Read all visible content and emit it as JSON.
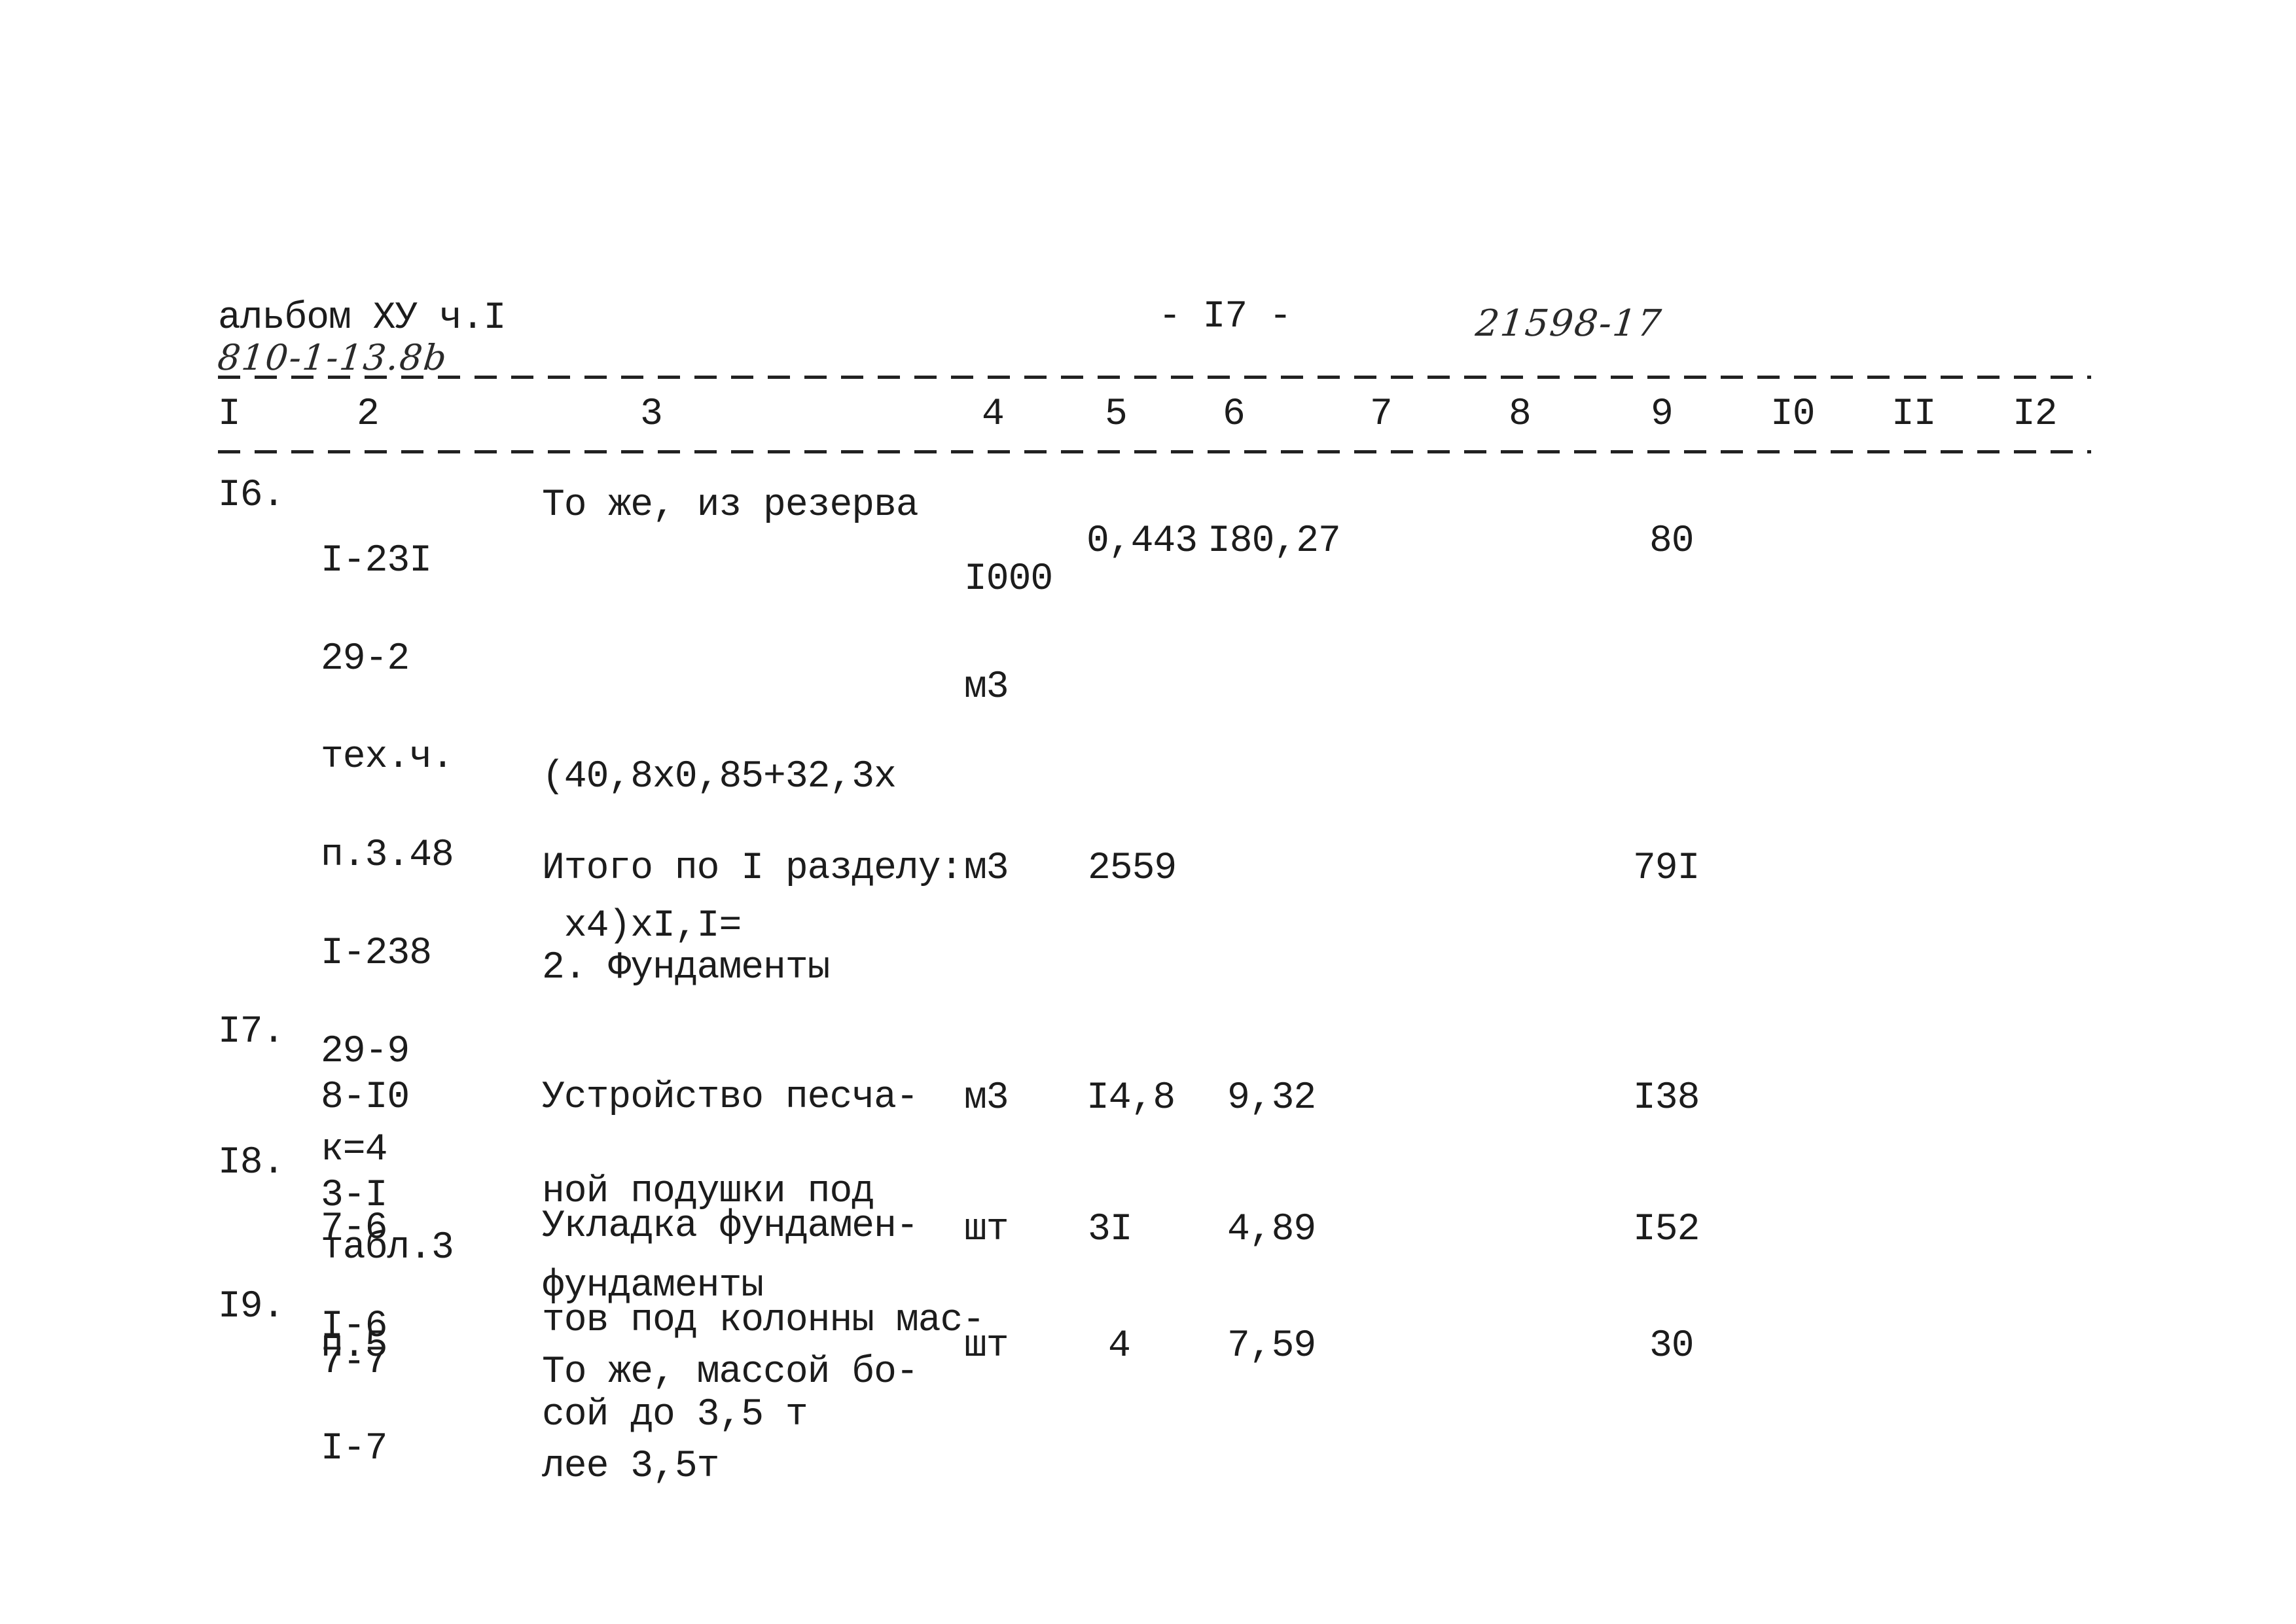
{
  "header": {
    "album": "альбом ХУ ч.I",
    "handwritten_code": "810-1-13.8b",
    "page_number": "- I7 -",
    "handwritten_number": "21598-17"
  },
  "columns": [
    "I",
    "2",
    "3",
    "4",
    "5",
    "6",
    "7",
    "8",
    "9",
    "I0",
    "II",
    "I2"
  ],
  "rows": [
    {
      "num": "I6.",
      "codes": [
        "I-23I",
        "29-2",
        "тех.ч.",
        "п.3.48",
        "I-238",
        "29-9",
        "к=4",
        "табл.3",
        "п.5"
      ],
      "description": [
        "То же, из резерва"
      ],
      "formula": [
        "(40,8х0,85+32,3х",
        " х4)хI,I="
      ],
      "unit": [
        "I000",
        "м3"
      ],
      "col5": "0,443",
      "col6": "I80,27",
      "col9": "80"
    },
    {
      "total_label": "Итого по I разделу:",
      "unit": "м3",
      "col5": "2559",
      "col9": "79I"
    },
    {
      "section_title": "2. Фундаменты"
    },
    {
      "num": "I7.",
      "codes": [
        "8-I0",
        "3-I"
      ],
      "description": [
        "Устройство песча-",
        "ной подушки под",
        "фундаменты"
      ],
      "unit": "м3",
      "col5": "I4,8",
      "col6": "9,32",
      "col9": "I38"
    },
    {
      "num": "I8.",
      "codes": [
        "7-6",
        "I-6"
      ],
      "description": [
        "Укладка фундамен-",
        "тов под колонны мас-",
        "сой до 3,5 т"
      ],
      "unit": "шт",
      "col5": "3I",
      "col6": "4,89",
      "col9": "I52"
    },
    {
      "num": "I9.",
      "codes": [
        "7-7",
        "I-7"
      ],
      "description": [
        "То же, массой бо-",
        "лее 3,5т"
      ],
      "unit": "шт",
      "col5": "4",
      "col6": "7,59",
      "col9": "30"
    }
  ]
}
